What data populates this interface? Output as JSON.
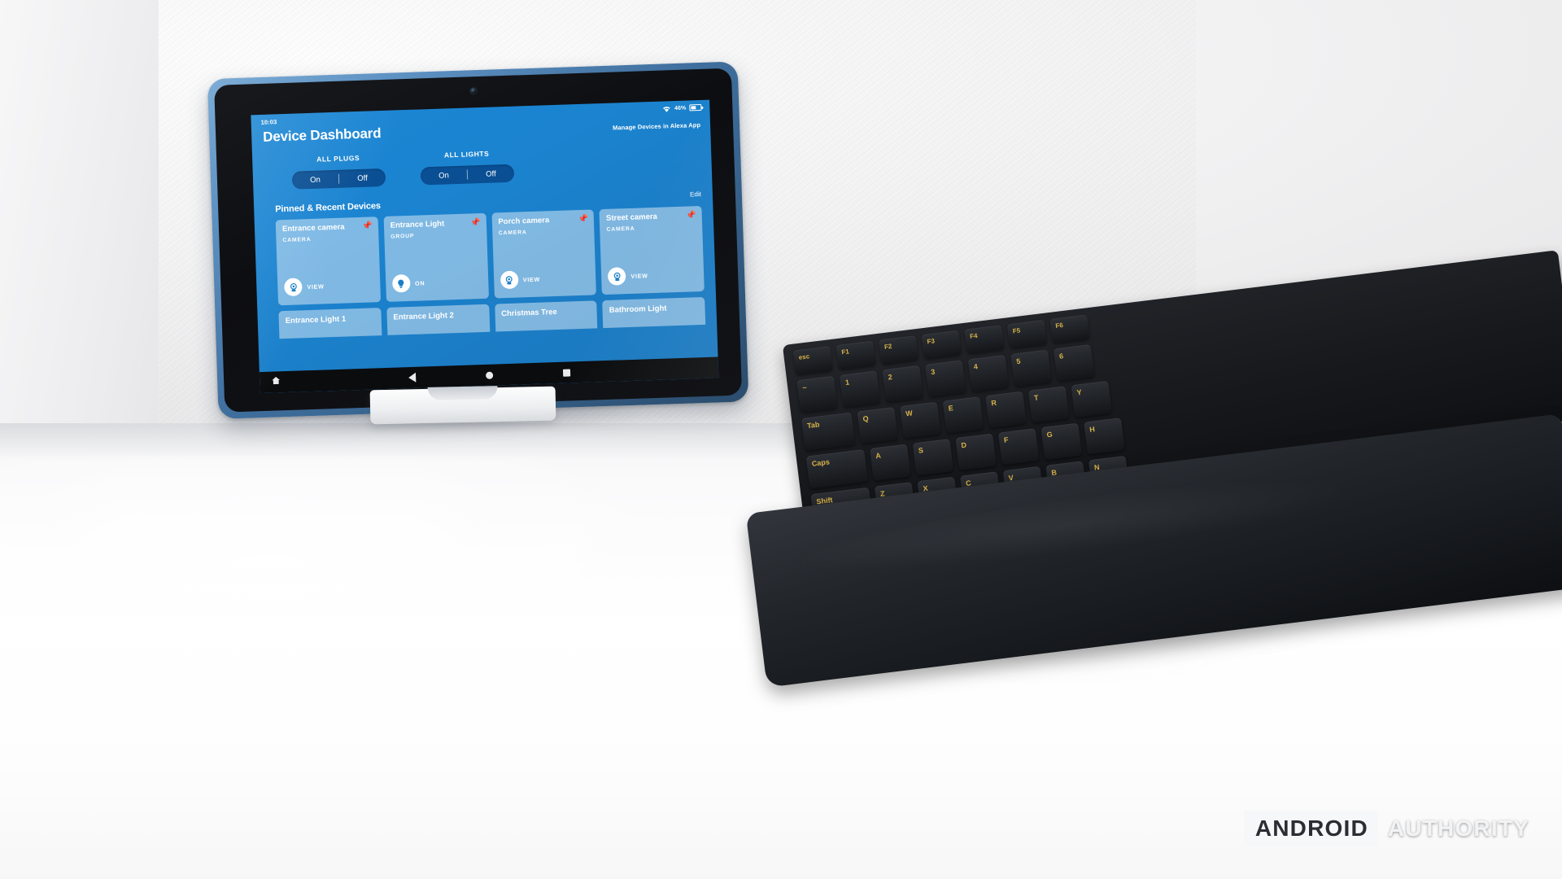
{
  "device": {
    "status_bar": {
      "time": "10:03",
      "wifi_icon": "wifi-icon",
      "battery_percent": "46%",
      "battery_icon": "battery-icon"
    },
    "header": {
      "title": "Device Dashboard",
      "manage_link": "Manage Devices in Alexa App"
    },
    "global_controls": [
      {
        "label": "ALL PLUGS",
        "on": "On",
        "off": "Off"
      },
      {
        "label": "ALL LIGHTS",
        "on": "On",
        "off": "Off"
      }
    ],
    "pinned_section": {
      "title": "Pinned & Recent Devices",
      "edit": "Edit"
    },
    "cards": [
      {
        "name": "Entrance camera",
        "type": "CAMERA",
        "action": "VIEW",
        "icon": "camera-icon",
        "pin": "pin-icon"
      },
      {
        "name": "Entrance Light",
        "type": "GROUP",
        "action": "ON",
        "icon": "lightbulb-icon",
        "pin": "pin-icon"
      },
      {
        "name": "Porch camera",
        "type": "CAMERA",
        "action": "VIEW",
        "icon": "camera-icon",
        "pin": "pin-icon"
      },
      {
        "name": "Street camera",
        "type": "CAMERA",
        "action": "VIEW",
        "icon": "camera-icon",
        "pin": "pin-icon"
      }
    ],
    "cards_row2": [
      {
        "name": "Entrance Light 1"
      },
      {
        "name": "Entrance Light 2"
      },
      {
        "name": "Christmas Tree"
      },
      {
        "name": "Bathroom Light"
      }
    ],
    "navbar": {
      "home_icon": "home-icon",
      "back_icon": "back-triangle-icon",
      "circle_icon": "home-circle-icon",
      "recents_icon": "recents-square-icon"
    },
    "colors": {
      "screen_blue": "#1b84d1",
      "segment_blue": "#0a4f94",
      "card_overlay": "rgba(255,255,255,0.44)",
      "pin_yellow": "#f5c518",
      "bezel_black": "#0d0e11",
      "tablet_blue": "#5f93c4"
    }
  },
  "keyboard": {
    "row_fn": [
      "esc",
      "F1",
      "F2",
      "F3",
      "F4",
      "F5",
      "F6"
    ],
    "row_num": [
      "~",
      "1",
      "2",
      "3",
      "4",
      "5",
      "6"
    ],
    "row_qwerty": [
      "Tab",
      "Q",
      "W",
      "E",
      "R",
      "T",
      "Y"
    ],
    "row_asdf": [
      "Caps",
      "A",
      "S",
      "D",
      "F",
      "G",
      "H"
    ],
    "row_zxcv": [
      "Shift",
      "Z",
      "X",
      "C",
      "V",
      "B",
      "N"
    ]
  },
  "watermark": {
    "primary": "ANDROID",
    "secondary": "AUTHORITY"
  }
}
